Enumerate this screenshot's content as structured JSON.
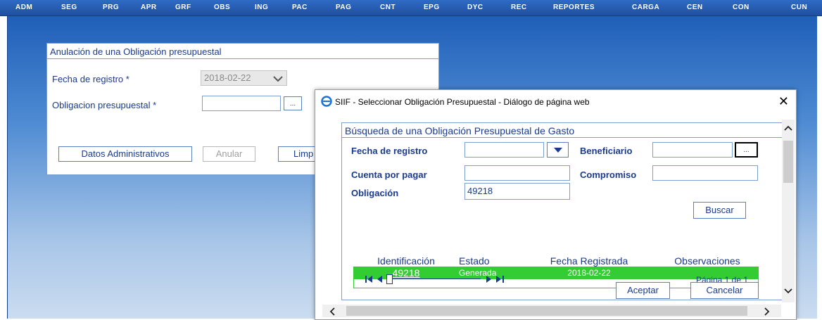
{
  "menu": [
    "ADM",
    "SEG",
    "PRG",
    "APR",
    "GRF",
    "OBS",
    "ING",
    "PAC",
    "PAG",
    "CNT",
    "EPG",
    "DYC",
    "REC",
    "REPORTES",
    "CARGA",
    "CEN",
    "CON",
    "CUN"
  ],
  "main_form": {
    "title": "Anulación de una Obligación presupuestal",
    "fecha_label": "Fecha de registro *",
    "fecha_value": "2018-02-22",
    "obligacion_label": "Obligacion presupuestal *",
    "obligacion_value": "",
    "dots": "...",
    "btn_datos": "Datos Administrativos",
    "btn_anular": "Anular",
    "btn_limpiar": "Limp"
  },
  "dialog": {
    "title": "SIIF - Seleccionar Obligación Presupuestal - Diálogo de página web",
    "close": "✕",
    "section_title": "Búsqueda de una Obligación Presupuestal de Gasto",
    "fecha_label": "Fecha de registro",
    "beneficiario_label": "Beneficiario",
    "cuenta_label": "Cuenta por pagar",
    "compromiso_label": "Compromiso",
    "obligacion_label": "Obligación",
    "obligacion_value": "49218",
    "dots": "...",
    "btn_buscar": "Buscar",
    "table": {
      "headers": [
        "Identificación",
        "Estado",
        "Fecha Registrada",
        "Observaciones"
      ],
      "rows": [
        {
          "id": "49218",
          "estado": "Generada",
          "fecha": "2018-02-22",
          "obs": ""
        }
      ]
    },
    "pager_text": "Página 1 de 1",
    "btn_aceptar": "Aceptar",
    "btn_cancelar": "Cancelar"
  }
}
